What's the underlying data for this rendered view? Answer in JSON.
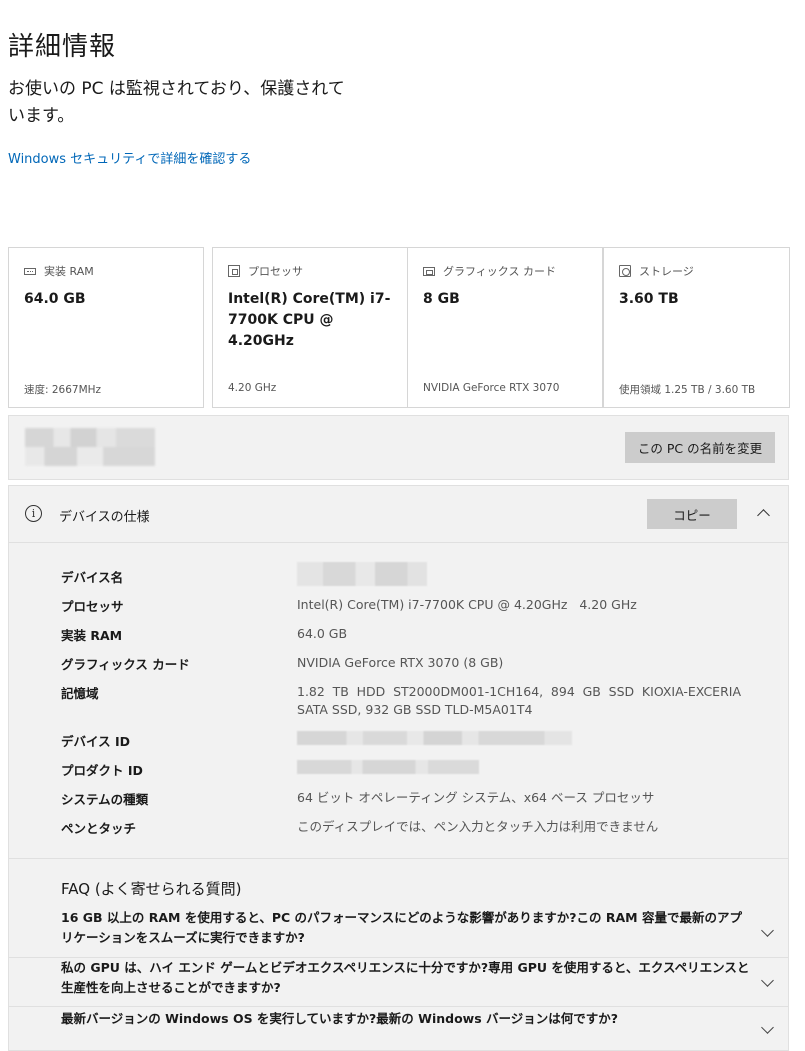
{
  "page": {
    "title": "詳細情報",
    "protection_message": "お使いの PC は監視されており、保護されています。",
    "security_link": "Windows セキュリティで詳細を確認する"
  },
  "cards": [
    {
      "label": "実装 RAM",
      "value": "64.0 GB",
      "sub": "速度: 2667MHz",
      "icon": "ram-icon"
    },
    {
      "label": "プロセッサ",
      "value": "Intel(R) Core(TM) i7-7700K CPU @ 4.20GHz",
      "sub": "4.20 GHz",
      "icon": "processor-icon"
    },
    {
      "label": "グラフィックス カード",
      "value": "8 GB",
      "sub": "NVIDIA GeForce RTX 3070",
      "icon": "graphics-card-icon"
    },
    {
      "label": "ストレージ",
      "value": "3.60 TB",
      "sub": "使用領域 1.25 TB / 3.60 TB",
      "icon": "storage-icon"
    }
  ],
  "rename": {
    "button_label": "この PC の名前を変更"
  },
  "specs": {
    "title": "デバイスの仕様",
    "copy_label": "コピー",
    "rows": [
      {
        "label": "デバイス名",
        "value": ""
      },
      {
        "label": "プロセッサ",
        "value": "Intel(R) Core(TM) i7-7700K CPU @ 4.20GHz   4.20 GHz"
      },
      {
        "label": "実装 RAM",
        "value": "64.0 GB"
      },
      {
        "label": "グラフィックス カード",
        "value": "NVIDIA GeForce RTX 3070 (8 GB)"
      },
      {
        "label": "記憶域",
        "value": "1.82 TB HDD ST2000DM001-1CH164, 894 GB SSD KIOXIA-EXCERIA SATA SSD, 932 GB SSD TLD-M5A01T4"
      },
      {
        "label": "デバイス ID",
        "value": ""
      },
      {
        "label": "プロダクト ID",
        "value": ""
      },
      {
        "label": "システムの種類",
        "value": "64 ビット オペレーティング システム、x64 ベース プロセッサ"
      },
      {
        "label": "ペンとタッチ",
        "value": "このディスプレイでは、ペン入力とタッチ入力は利用できません"
      }
    ]
  },
  "faq": {
    "title": "FAQ (よく寄せられる質問)",
    "items": [
      "16 GB 以上の RAM を使用すると、PC のパフォーマンスにどのような影響がありますか?この RAM 容量で最新のアプリケーションをスムーズに実行できますか?",
      "私の GPU は、ハイ エンド ゲームとビデオエクスペリエンスに十分ですか?専用 GPU を使用すると、エクスペリエンスと生産性を向上させることができますか?",
      "最新バージョンの Windows OS を実行していますか?最新の Windows バージョンは何ですか?"
    ]
  }
}
